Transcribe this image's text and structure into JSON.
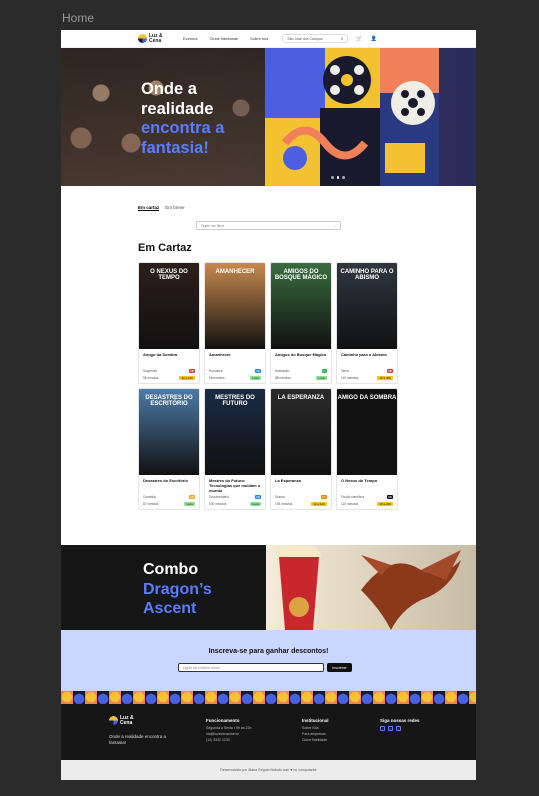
{
  "frame_title": "Home",
  "header": {
    "logo": "Luz & Cena",
    "nav": [
      "Eventos",
      "Clube fidelidade",
      "Sobre nós"
    ],
    "city": "São José dos Campos"
  },
  "hero": {
    "line1": "Onde a",
    "line2": "realidade",
    "line3": "encontra a",
    "line4": "fantasia!"
  },
  "tabs": [
    "Em cartaz",
    "Em breve"
  ],
  "search": {
    "placeholder": "Digite um filme"
  },
  "section_title": "Em Cartaz",
  "movies": [
    {
      "poster_text": "O NEXUS DO TEMPO",
      "name": "Amigo da Sombra",
      "genre": "Suspense",
      "rating": "18",
      "rating_color": "#e23b3b",
      "duration": "98 minutos",
      "badge": "12 a 14h",
      "badge_color": "#f5c518",
      "poster_color": "#2c1f1a"
    },
    {
      "poster_text": "AMANHECER",
      "name": "Amanhecer",
      "genre": "Romance",
      "rating": "10",
      "rating_color": "#1e8ee0",
      "duration": "96 minutos",
      "badge": "Livre",
      "badge_color": "#8de08d",
      "poster_color": "#c7894f"
    },
    {
      "poster_text": "AMIGOS DO BOSQUE MÁGICO",
      "name": "Amigos do Bosque Mágico",
      "genre": "Animação",
      "rating": "L",
      "rating_color": "#2fb24a",
      "duration": "88 minutos",
      "badge": "Livre",
      "badge_color": "#8de08d",
      "poster_color": "#3a6b3e"
    },
    {
      "poster_text": "CAMINHO PARA O ABISMO",
      "name": "Caminho para o Abismo",
      "genre": "Terror",
      "rating": "18",
      "rating_color": "#e23b3b",
      "duration": "110 minutos",
      "badge": "18 a 20h",
      "badge_color": "#f5c518",
      "poster_color": "#2f3740"
    },
    {
      "poster_text": "DESASTRES DO ESCRITÓRIO",
      "name": "Desastres do Escritório",
      "genre": "Comédia",
      "rating": "12",
      "rating_color": "#f5a623",
      "duration": "87 minutos",
      "badge": "Livre",
      "badge_color": "#8de08d",
      "poster_color": "#4e7aa8"
    },
    {
      "poster_text": "MESTRES DO FUTURO",
      "name": "Mestres do Futuro: Tecnologias que moldam o mundo",
      "genre": "Documentário",
      "rating": "10",
      "rating_color": "#1e8ee0",
      "duration": "100 minutos",
      "badge": "Livre",
      "badge_color": "#8de08d",
      "poster_color": "#1b2b45"
    },
    {
      "poster_text": "LA ESPERANZA",
      "name": "La Esperanza",
      "genre": "Drama",
      "rating": "14",
      "rating_color": "#f07a1a",
      "duration": "105 minutos",
      "badge": "12 a 14h",
      "badge_color": "#f5c518",
      "poster_color": "#2a2a2a"
    },
    {
      "poster_text": "AMIGO DA SOMBRA",
      "name": "O Nexus do Tempo",
      "genre": "Ficção científica",
      "rating": "16",
      "rating_color": "#111111",
      "duration": "110 minutos",
      "badge": "18 a 20h",
      "badge_color": "#f5c518",
      "poster_color": "#111111"
    }
  ],
  "combo": {
    "line1": "Combo",
    "line2": "Dragon’s",
    "line3": "Ascent"
  },
  "newsletter": {
    "title": "Inscreva-se para ganhar descontos!",
    "placeholder": "Digite seu melhor email",
    "button": "Inscrever"
  },
  "footer": {
    "tagline": "Onde a realidade encontra a fantasia!",
    "col1_title": "Funcionamento",
    "col1_lines": [
      "Segunda a Sexta • 9h às 22h",
      "ola@luzecenacine.br",
      "(12) 3332 1233"
    ],
    "col2_title": "Institucional",
    "col2_lines": [
      "Sobre Nós",
      "Para empresas",
      "Clube fidelidade"
    ],
    "col3_title": "Siga nossas redes"
  },
  "credits": "Desenvolvido por Alana Grígolo Nobuto com ♥ no computador",
  "colors": {
    "accent": "#5a7dff",
    "dark": "#161616",
    "newsletter_bg": "#c9d7ff"
  }
}
